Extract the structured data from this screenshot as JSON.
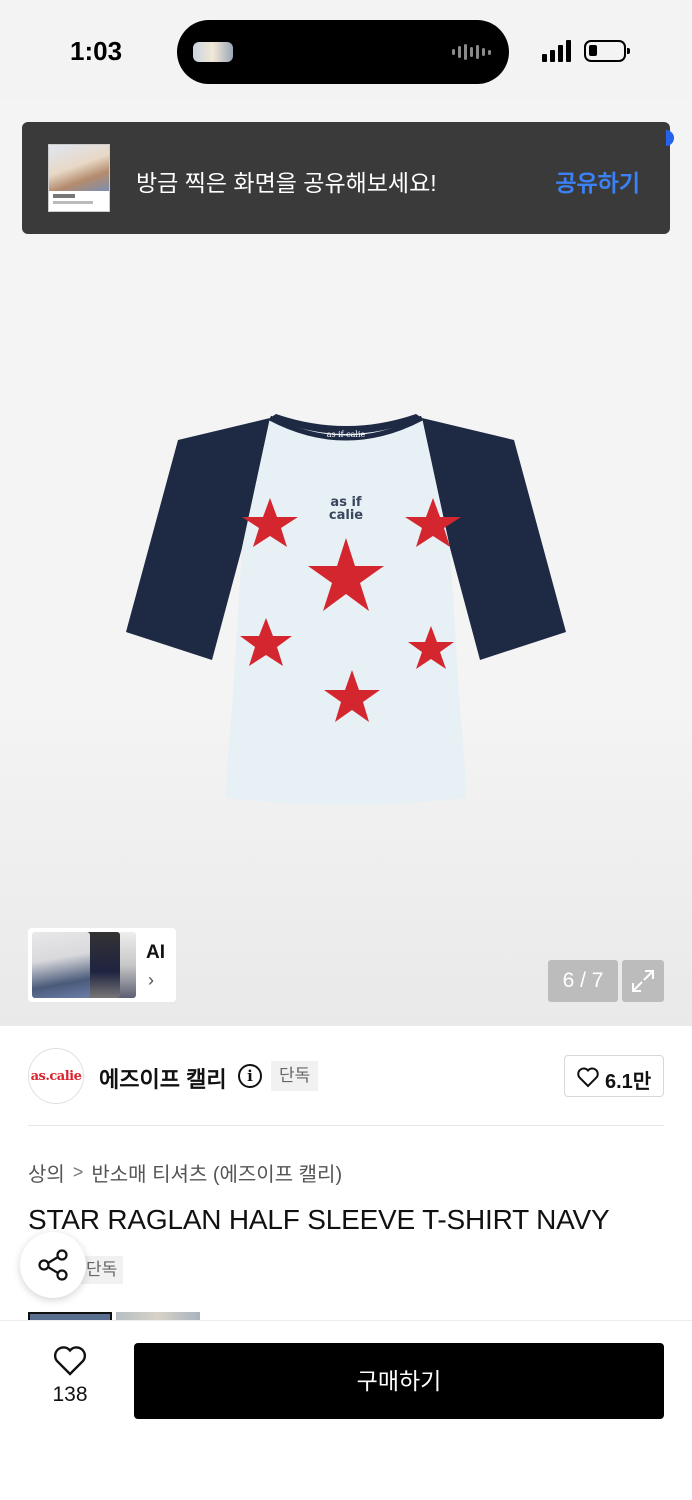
{
  "status_bar": {
    "time": "1:03"
  },
  "share_banner": {
    "text": "방금 찍은 화면을 공유해보세요!",
    "action": "공유하기",
    "action_color": "#3b82f6"
  },
  "gallery": {
    "ai_label": "AI",
    "page_counter": "6 / 7",
    "current_page": 6,
    "total_pages": 7
  },
  "product_print": {
    "collar_label": "as if calie",
    "chest_print": [
      "as if",
      "calie"
    ]
  },
  "brand": {
    "logo_text": "as.calie",
    "name": "에즈이프 캘리",
    "exclusive_tag": "단독",
    "likes": "6.1만"
  },
  "breadcrumb": {
    "category": "상의",
    "separator": ">",
    "subcategory": "반소매 티셔츠 (에즈이프 캘리)"
  },
  "product": {
    "title": "STAR RAGLAN HALF SLEEVE T-SHIRT NAVY",
    "exclusive_tag": "단독"
  },
  "bottom_bar": {
    "wish_count": "138",
    "buy_label": "구매하기"
  },
  "colors": {
    "accent": "#3b82f6",
    "brand_red": "#d9232e",
    "shirt_navy": "#1e2a44",
    "star_red": "#d4262f"
  }
}
